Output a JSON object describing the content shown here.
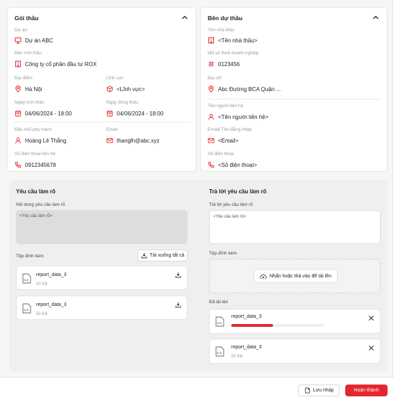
{
  "package": {
    "title": "Gói thầu",
    "project_label": "Dự án",
    "project_value": "Dự án ABC",
    "inviter_label": "Bên mời thầu",
    "inviter_value": "Công ty cổ phần đầu tư ROX",
    "location_label": "Địa điểm",
    "location_value": "Hà Nội",
    "field_label": "Lĩnh vực",
    "field_value": "<Lĩnh vực>",
    "invite_date_label": "Ngày mời thầu",
    "invite_date_value": "04/06/2024 - 18:00",
    "close_date_label": "Ngày đóng thầu",
    "close_date_value": "04/06/2024 - 18:00",
    "contact_label": "Đầu mối phụ trách",
    "contact_value": "Hoàng Lê Thắng",
    "email_label": "Email",
    "email_value": "thanglh@abc.xyz",
    "phone_label": "Số điện thoại liên hệ",
    "phone_value": "0912345678"
  },
  "bidder": {
    "title": "Bên dự thầu",
    "name_label": "Tên nhà thầu",
    "name_value": "<Tên nhà thầu>",
    "tax_label": "Mã số thuế doanh nghiệp",
    "tax_value": "0123456",
    "address_label": "Địa chỉ",
    "address_value": "Abc Đường BCA Quận ...",
    "contact_label": "Tên người liên hệ",
    "contact_value": "<Tên người liên hệ>",
    "email_label": "Email/ Tên đăng nhập",
    "email_value": "<Email>",
    "phone_label": "Số điện thoại",
    "phone_value": "<Số điện thoại>"
  },
  "request": {
    "title": "Yêu cầu làm rõ",
    "content_label": "Nội dung yêu cầu làm rõ",
    "content_value": "<Yêu cầu làm rõ>",
    "attachments_label": "Tệp đính kèm",
    "download_all": "Tải xuống tất cả",
    "files": [
      {
        "name": "report_data_3",
        "size": "50 KB"
      },
      {
        "name": "report_data_3",
        "size": "50 KB"
      }
    ]
  },
  "reply": {
    "title": "Trả lời yêu cầu làm rõ",
    "content_label": "Trả lời yêu cầu làm rõ",
    "content_placeholder": "<Yêu cầu làm rõ>",
    "attachments_label": "Tệp đính kèm",
    "upload_hint": "Nhấn hoặc thả vào để tải lên",
    "uploaded_label": "Đã tải lên",
    "uploading_file": {
      "name": "report_data_3",
      "progress": 0.45
    },
    "uploaded_file": {
      "name": "report_data_3",
      "size": "50 KB"
    }
  },
  "footer": {
    "draft_label": "Lưu nháp",
    "complete_label": "Hoàn thành"
  },
  "colors": {
    "accent": "#e3262f",
    "progress_track": "#eeeeee"
  }
}
